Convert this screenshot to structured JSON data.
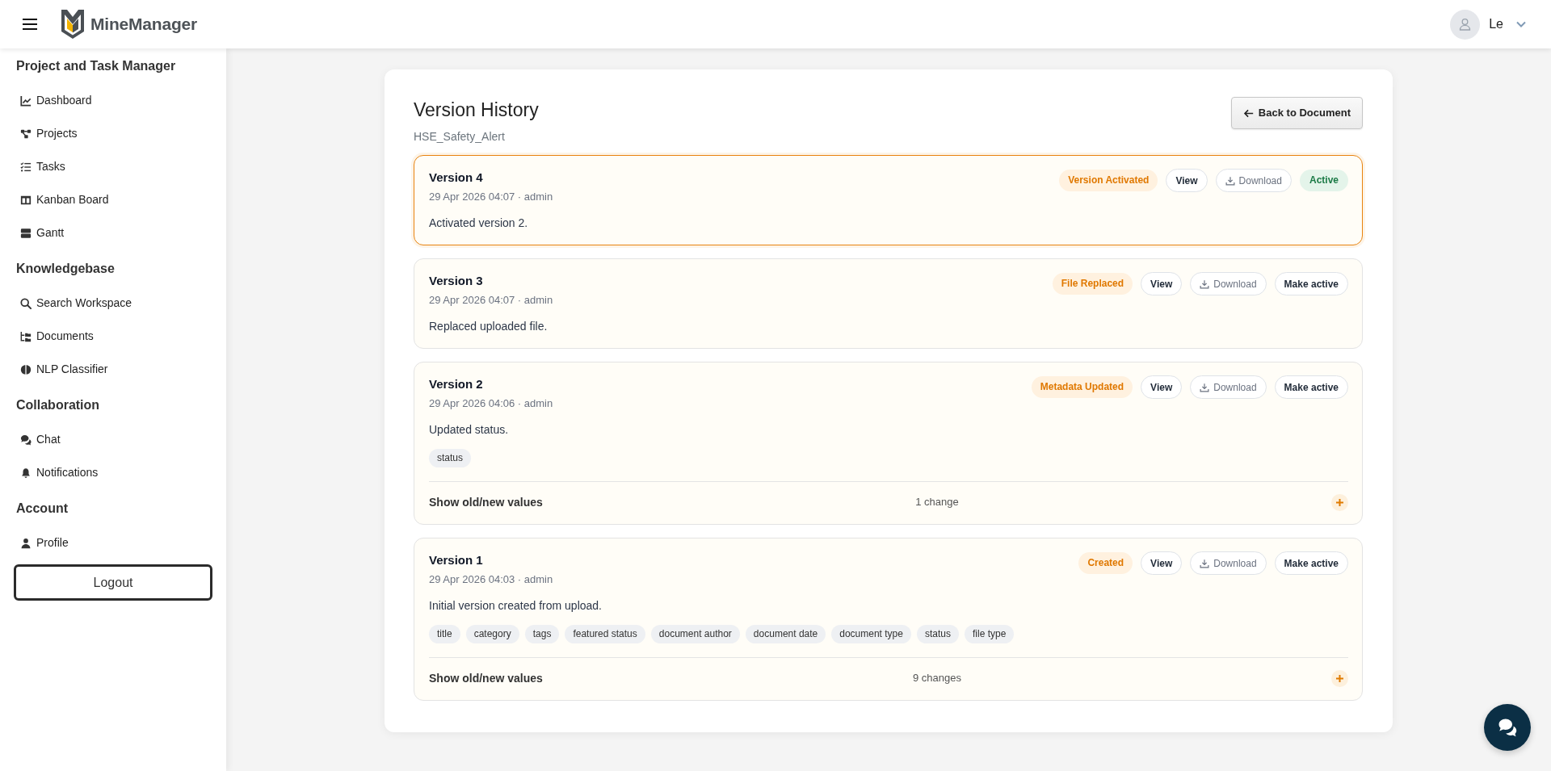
{
  "header": {
    "app_name": "MineManager",
    "user_name": "Le"
  },
  "sidebar": {
    "sections": [
      {
        "title": "Project and Task Manager",
        "items": [
          "Dashboard",
          "Projects",
          "Tasks",
          "Kanban Board",
          "Gantt"
        ]
      },
      {
        "title": "Knowledgebase",
        "items": [
          "Search Workspace",
          "Documents",
          "NLP Classifier"
        ]
      },
      {
        "title": "Collaboration",
        "items": [
          "Chat",
          "Notifications"
        ]
      },
      {
        "title": "Account",
        "items": [
          "Profile"
        ]
      }
    ],
    "logout": "Logout"
  },
  "page": {
    "title": "Version History",
    "subtitle": "HSE_Safety_Alert",
    "back_button": "Back to Document"
  },
  "versions": [
    {
      "title": "Version 4",
      "meta": "29 Apr 2026 04:07 · admin",
      "description": "Activated version 2.",
      "active": true,
      "event": "Version Activated",
      "view": "View",
      "download": "Download",
      "status": {
        "kind": "badge",
        "label": "Active"
      }
    },
    {
      "title": "Version 3",
      "meta": "29 Apr 2026 04:07 · admin",
      "description": "Replaced uploaded file.",
      "active": false,
      "event": "File Replaced",
      "view": "View",
      "download": "Download",
      "status": {
        "kind": "button",
        "label": "Make active"
      }
    },
    {
      "title": "Version 2",
      "meta": "29 Apr 2026 04:06 · admin",
      "description": "Updated status.",
      "active": false,
      "event": "Metadata Updated",
      "view": "View",
      "download": "Download",
      "status": {
        "kind": "button",
        "label": "Make active"
      },
      "fields": [
        "status"
      ],
      "changes": {
        "toggle": "Show old/new values",
        "count": "1 change",
        "expanded": false
      }
    },
    {
      "title": "Version 1",
      "meta": "29 Apr 2026 04:03 · admin",
      "description": "Initial version created from upload.",
      "active": false,
      "event": "Created",
      "view": "View",
      "download": "Download",
      "status": {
        "kind": "button",
        "label": "Make active"
      },
      "fields": [
        "title",
        "category",
        "tags",
        "featured status",
        "document author",
        "document date",
        "document type",
        "status",
        "file type"
      ],
      "changes": {
        "toggle": "Show old/new values",
        "count": "9 changes",
        "expanded": false
      }
    }
  ]
}
